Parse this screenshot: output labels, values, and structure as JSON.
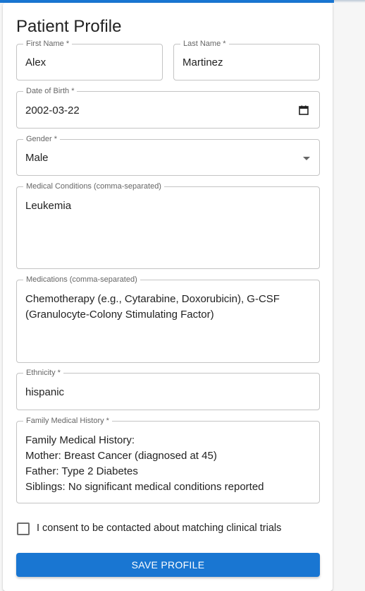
{
  "form": {
    "title": "Patient Profile",
    "first_name": {
      "label": "First Name *",
      "value": "Alex"
    },
    "last_name": {
      "label": "Last Name *",
      "value": "Martinez"
    },
    "date_of_birth": {
      "label": "Date of Birth *",
      "value": "2002-03-22"
    },
    "gender": {
      "label": "Gender *",
      "value": "Male"
    },
    "medical_conditions": {
      "label": "Medical Conditions (comma-separated)",
      "value": "Leukemia"
    },
    "medications": {
      "label": "Medications (comma-separated)",
      "value": "Chemotherapy (e.g., Cytarabine, Doxorubicin), G-CSF\n(Granulocyte-Colony Stimulating Factor)"
    },
    "ethnicity": {
      "label": "Ethnicity *",
      "value": "hispanic"
    },
    "family_history": {
      "label": "Family Medical History *",
      "value": "Family Medical History:\nMother: Breast Cancer (diagnosed at 45)\nFather: Type 2 Diabetes\nSiblings: No significant medical conditions reported"
    },
    "consent_label": "I consent to be contacted about matching clinical trials",
    "consent_checked": false,
    "save_label": "SAVE PROFILE"
  },
  "colors": {
    "accent": "#1976d2",
    "border": "#c4c4c4"
  },
  "icons": {
    "date_picker": "calendar-icon",
    "select": "caret-down-icon"
  }
}
